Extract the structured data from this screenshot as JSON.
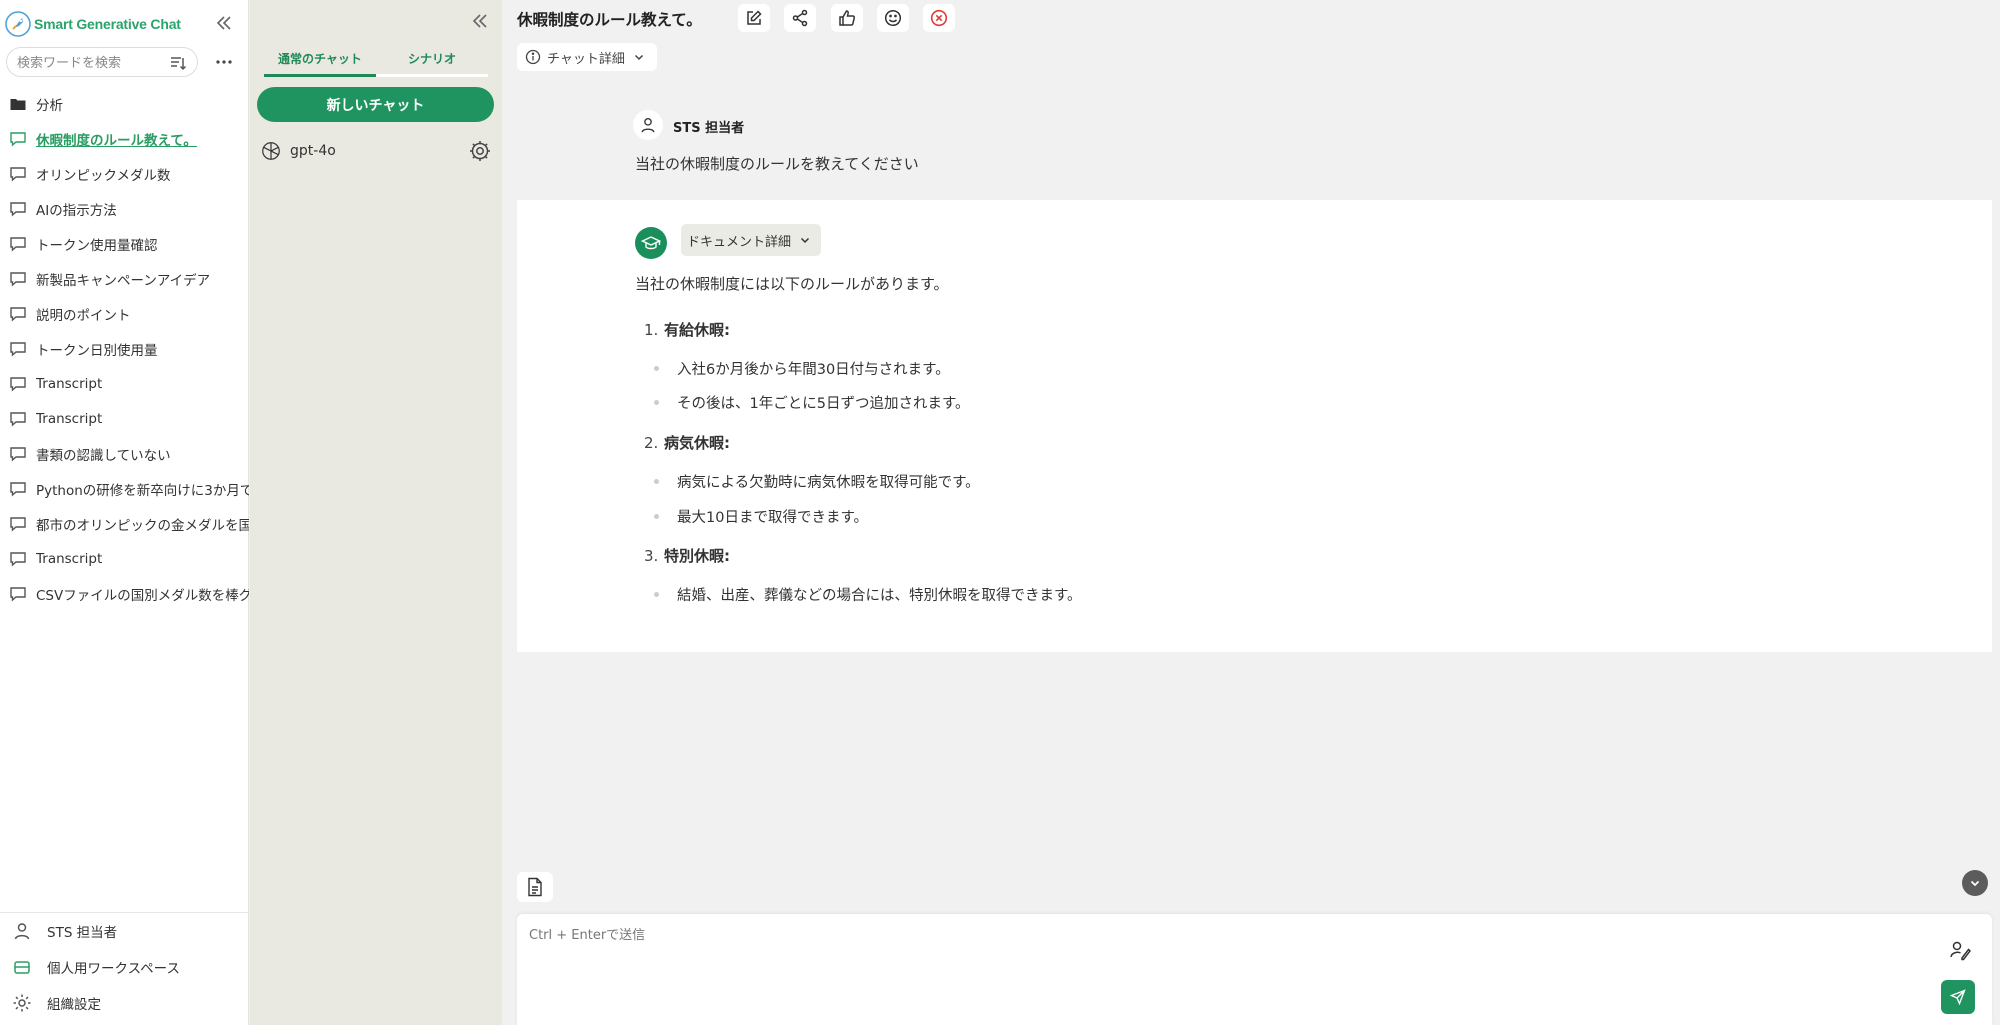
{
  "sidebar": {
    "brand_text": "Smart Generative Chat",
    "search_placeholder": "検索ワードを検索",
    "items": [
      {
        "label": "分析",
        "icon": "folder-icon"
      },
      {
        "label": "休暇制度のルール教えて。",
        "icon": "chat-bubble-icon",
        "active": true
      },
      {
        "label": "オリンピックメダル数",
        "icon": "chat-bubble-icon"
      },
      {
        "label": "AIの指示方法",
        "icon": "chat-bubble-icon"
      },
      {
        "label": "トークン使用量確認",
        "icon": "chat-bubble-icon"
      },
      {
        "label": "新製品キャンペーンアイデア",
        "icon": "chat-bubble-icon"
      },
      {
        "label": "説明のポイント",
        "icon": "chat-bubble-icon"
      },
      {
        "label": "トークン日別使用量",
        "icon": "chat-bubble-icon"
      },
      {
        "label": "Transcript",
        "icon": "chat-bubble-icon"
      },
      {
        "label": "Transcript",
        "icon": "chat-bubble-icon"
      },
      {
        "label": "書類の認識していない",
        "icon": "chat-bubble-icon"
      },
      {
        "label": "Pythonの研修を新卒向けに3か月で",
        "icon": "chat-bubble-icon"
      },
      {
        "label": "都市のオリンピックの金メダルを国",
        "icon": "chat-bubble-icon"
      },
      {
        "label": "Transcript",
        "icon": "chat-bubble-icon"
      },
      {
        "label": "CSVファイルの国別メダル数を棒グ",
        "icon": "chat-bubble-icon"
      }
    ],
    "bottom": {
      "user": "STS 担当者",
      "workspace": "個人用ワークスペース",
      "org_settings": "組織設定"
    }
  },
  "panel2": {
    "tabs": [
      "通常のチャット",
      "シナリオ"
    ],
    "new_chat": "新しいチャット",
    "model": "gpt-4o"
  },
  "main": {
    "title": "休暇制度のルール教えて。",
    "chat_detail": "チャット詳細",
    "user_message": {
      "name": "STS 担当者",
      "text": "当社の休暇制度のルールを教えてください"
    },
    "bot_message": {
      "doc_detail": "ドキュメント詳細",
      "intro": "当社の休暇制度には以下のルールがあります。",
      "sections": [
        {
          "num": "1.",
          "title": "有給休暇:",
          "bullets": [
            "入社6か月後から年間30日付与されます。",
            "その後は、1年ごとに5日ずつ追加されます。"
          ]
        },
        {
          "num": "2.",
          "title": "病気休暇:",
          "bullets": [
            "病気による欠勤時に病気休暇を取得可能です。",
            "最大10日まで取得できます。"
          ]
        },
        {
          "num": "3.",
          "title": "特別休暇:",
          "bullets": [
            "結婚、出産、葬儀などの場合には、特別休暇を取得できます。"
          ]
        }
      ]
    },
    "input_placeholder": "Ctrl + Enterで送信"
  },
  "colors": {
    "accent": "#1f9460",
    "brand_text": "#2aa36c",
    "panel_bg": "#e9e8e1",
    "close_red": "#e03b3b"
  }
}
